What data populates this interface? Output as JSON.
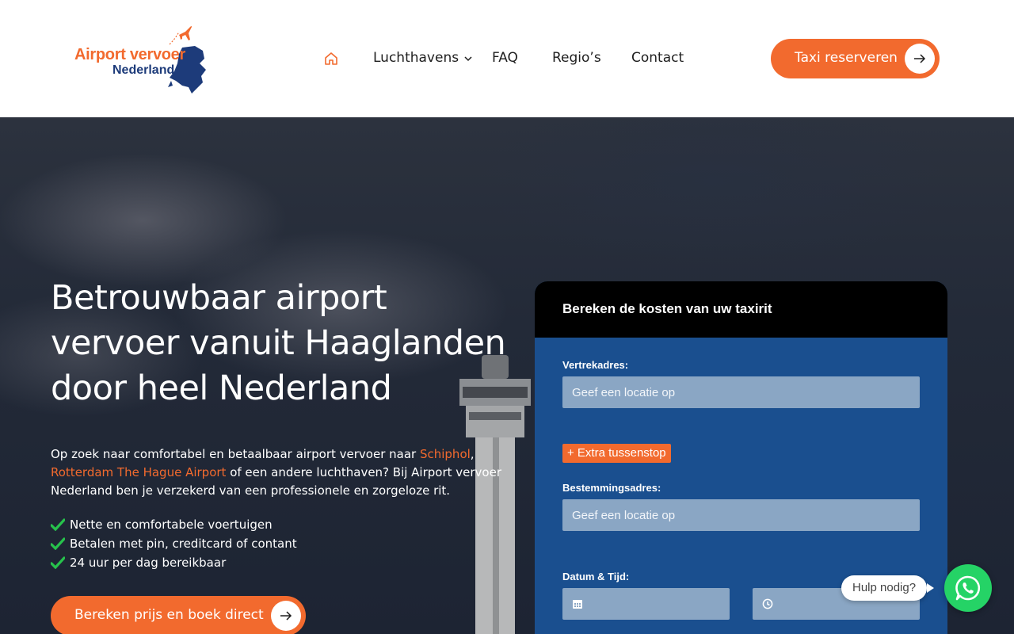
{
  "header": {
    "logo": {
      "line1": "Airport vervoer",
      "line2": "Nederland",
      "icon": "plane-netherlands-map-logo"
    },
    "nav": {
      "home_icon": "home-icon",
      "items": [
        {
          "label": "Luchthavens",
          "has_dropdown": true
        },
        {
          "label": "FAQ"
        },
        {
          "label": "Regio’s"
        },
        {
          "label": "Contact"
        }
      ]
    },
    "cta": {
      "label": "Taxi reserveren",
      "icon": "arrow-right-icon"
    }
  },
  "hero": {
    "title_lines": [
      "Betrouwbaar airport",
      "vervoer vanuit Haaglanden",
      "door heel Nederland"
    ],
    "intro": {
      "part1": "Op zoek naar comfortabel en betaalbaar airport vervoer naar ",
      "link1": "Schiphol",
      "part2": ", ",
      "link2": "Rotterdam The Hague Airport",
      "part3": " of een andere luchthaven? Bij Airport vervoer Nederland ben je verzekerd van een professionele en zorgeloze rit."
    },
    "checks": [
      "Nette en comfortabele voertuigen",
      "Betalen met pin, creditcard of contant",
      "24 uur per dag bereikbaar"
    ],
    "button": {
      "label": "Bereken prijs en boek direct",
      "icon": "arrow-right-icon"
    }
  },
  "form": {
    "title": "Bereken de kosten van uw taxirit",
    "departure": {
      "label": "Vertrekadres:",
      "placeholder": "Geef een locatie op",
      "value": ""
    },
    "extra_stop": "+ Extra tussenstop",
    "destination": {
      "label": "Bestemmingsadres:",
      "placeholder": "Geef een locatie op",
      "value": ""
    },
    "datetime": {
      "label": "Datum & Tijd:",
      "date_icon": "calendar-icon",
      "time_icon": "clock-icon"
    }
  },
  "help": {
    "label": "Hulp nodig?",
    "icon": "whatsapp-icon"
  },
  "colors": {
    "accent": "#f26a2e",
    "form_bg": "#1a4f8f",
    "input_bg": "#8aa6c4",
    "whatsapp": "#25d366",
    "check": "#27c24c"
  }
}
